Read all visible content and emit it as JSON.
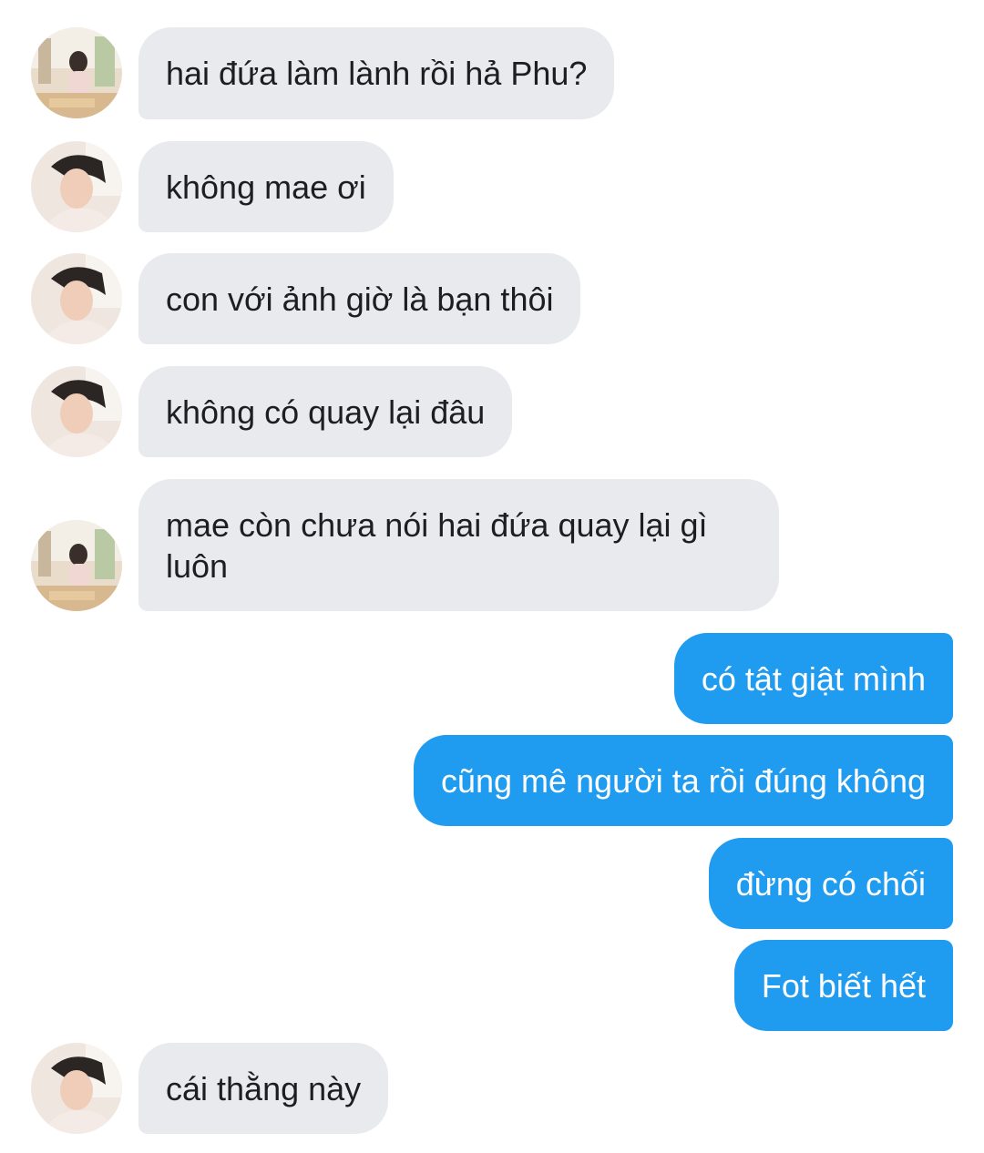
{
  "messages": [
    {
      "side": "in",
      "avatar": "mae-avatar",
      "text": "hai đứa làm lành rồi hả Phu?"
    },
    {
      "side": "in",
      "avatar": "phu-avatar",
      "text": "không mae ơi"
    },
    {
      "side": "in",
      "avatar": "phu-avatar",
      "text": "con với ảnh giờ là bạn thôi"
    },
    {
      "side": "in",
      "avatar": "phu-avatar",
      "text": "không có quay lại đâu"
    },
    {
      "side": "in",
      "avatar": "mae-avatar",
      "text": "mae còn chưa nói hai đứa quay lại gì luôn"
    },
    {
      "side": "out",
      "text": "có tật giật mình"
    },
    {
      "side": "out",
      "text": "cũng mê người ta rồi đúng không"
    },
    {
      "side": "out",
      "text": "đừng có chối"
    },
    {
      "side": "out",
      "text": "Fot biết hết"
    },
    {
      "side": "in",
      "avatar": "phu-avatar",
      "text": "cái thằng này"
    }
  ],
  "colors": {
    "incoming_bubble": "#e8eaee",
    "outgoing_bubble": "#1f9bf0",
    "incoming_text": "#1c1e21",
    "outgoing_text": "#ffffff",
    "background": "#ffffff"
  }
}
